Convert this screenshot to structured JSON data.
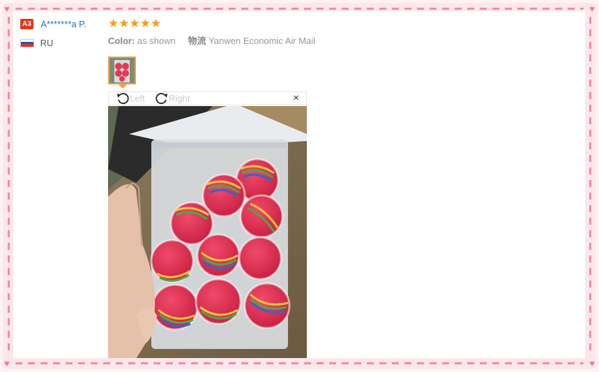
{
  "review": {
    "level_badge": "A3",
    "user_name": "A*******a P.",
    "country_code": "RU",
    "stars": "★★★★★",
    "color_label": "Color:",
    "color_value": "as shown",
    "shipping_label": "物流",
    "shipping_value": "Yanwen Economic Air Mail"
  },
  "viewer": {
    "rotate_left_label": "Left",
    "rotate_right_label": "Right",
    "close_label": "×"
  },
  "colors": {
    "accent": "#f79a1c",
    "link": "#1f6fb5",
    "frame": "#f08da3"
  }
}
